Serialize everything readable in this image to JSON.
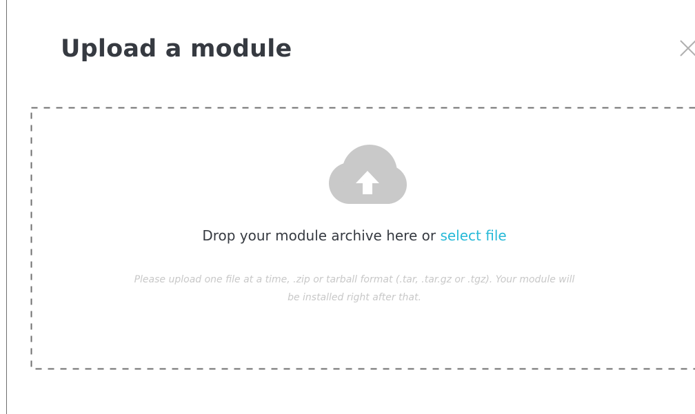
{
  "modal": {
    "title": "Upload a module",
    "close_icon": "close-icon"
  },
  "dropzone": {
    "icon": "cloud-upload-icon",
    "drop_text": "Drop your module archive here or",
    "select_link": "select file",
    "help_line_1": "Please upload one file at a time, .zip or tarball format (.tar, .tar.gz or .tgz). Your module will",
    "help_line_2": "be installed right after that."
  },
  "colors": {
    "title": "#363a41",
    "link": "#25b9d7",
    "icon": "#c9c9c9",
    "help_text": "#c8c8c8",
    "border": "#6f6f6f"
  }
}
